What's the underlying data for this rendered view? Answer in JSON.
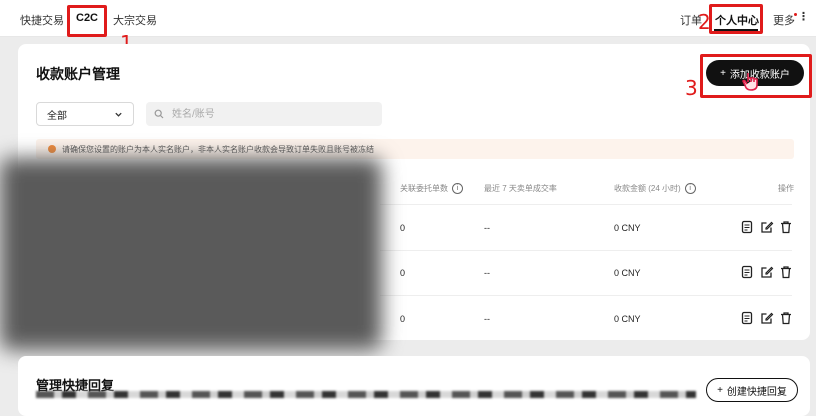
{
  "topnav": {
    "left": [
      "快捷交易",
      "C2C",
      "大宗交易"
    ],
    "right": [
      "订单",
      "个人中心",
      "更多"
    ],
    "active_left": "C2C",
    "active_right": "个人中心"
  },
  "annotations": [
    "1",
    "2",
    "3"
  ],
  "page": {
    "title": "收款账户管理",
    "add_button": "添加收款账户",
    "filter": {
      "selected": "全部",
      "search_placeholder": "姓名/账号"
    },
    "warning": "请确保您设置的账户为本人实名账户，非本人实名账户收款会导致订单失败且账号被冻结"
  },
  "table": {
    "headers": [
      "关联委托单数",
      "最近 7 天卖单成交率",
      "收款金额 (24 小时)",
      "操作"
    ],
    "rows": [
      {
        "orders": "0",
        "rate": "--",
        "amount": "0 CNY"
      },
      {
        "orders": "0",
        "rate": "--",
        "amount": "0 CNY"
      },
      {
        "orders": "0",
        "rate": "--",
        "amount": "0 CNY"
      }
    ]
  },
  "quick_reply": {
    "title": "管理快捷回复",
    "create_button": "创建快捷回复"
  },
  "colors": {
    "annotation": "#e01b1b",
    "primary_button": "#111111",
    "warning_icon": "#f08a3a",
    "warning_bg": "#fdf3ec"
  },
  "icons": [
    "chevron-down-icon",
    "search-icon",
    "info-icon",
    "plus-icon",
    "document-icon",
    "edit-icon",
    "trash-icon",
    "hand-cursor-icon",
    "more-icon",
    "warning-icon"
  ]
}
